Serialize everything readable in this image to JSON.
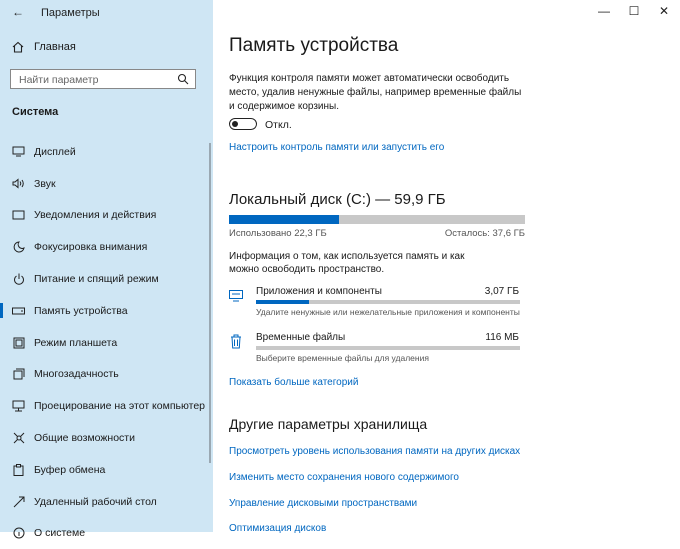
{
  "window": {
    "title": "Параметры",
    "back_icon": "arrow-left-icon",
    "minimize": "—",
    "maximize": "☐",
    "close": "✕"
  },
  "sidebar": {
    "home_label": "Главная",
    "search_placeholder": "Найти параметр",
    "section_title": "Система",
    "items": [
      {
        "label": "Дисплей",
        "icon": "display-icon"
      },
      {
        "label": "Звук",
        "icon": "speaker-icon"
      },
      {
        "label": "Уведомления и действия",
        "icon": "notification-icon"
      },
      {
        "label": "Фокусировка внимания",
        "icon": "moon-icon"
      },
      {
        "label": "Питание и спящий режим",
        "icon": "power-icon"
      },
      {
        "label": "Память устройства",
        "icon": "storage-icon",
        "active": true
      },
      {
        "label": "Режим планшета",
        "icon": "tablet-icon"
      },
      {
        "label": "Многозадачность",
        "icon": "multitask-icon"
      },
      {
        "label": "Проецирование на этот компьютер",
        "icon": "project-icon"
      },
      {
        "label": "Общие возможности",
        "icon": "shared-icon"
      },
      {
        "label": "Буфер обмена",
        "icon": "clipboard-icon"
      },
      {
        "label": "Удаленный рабочий стол",
        "icon": "remote-icon"
      },
      {
        "label": "О системе",
        "icon": "info-icon"
      }
    ]
  },
  "main": {
    "title": "Память устройства",
    "sense_description": "Функция контроля памяти может автоматически освободить место, удалив ненужные файлы, например временные файлы и содержимое корзины.",
    "toggle_state": "Откл.",
    "configure_link": "Настроить контроль памяти или запустить его",
    "disk_title": "Локальный диск (C:) — 59,9 ГБ",
    "disk_used_fraction": 0.373,
    "used_label": "Использовано 22,3 ГБ",
    "free_label": "Осталось: 37,6 ГБ",
    "info_text": "Информация о том, как используется память и как можно освободить пространство.",
    "categories": [
      {
        "name": "Приложения и компоненты",
        "size": "3,07 ГБ",
        "desc": "Удалите ненужные или нежелательные приложения и компоненты",
        "fraction": 0.2
      },
      {
        "name": "Временные файлы",
        "size": "116 МБ",
        "desc": "Выберите временные файлы для удаления",
        "fraction": 0.0
      }
    ],
    "more_link": "Показать больше категорий",
    "other_title": "Другие параметры хранилища",
    "other_links": [
      "Просмотреть уровень использования памяти на других дисках",
      "Изменить место сохранения нового содержимого",
      "Управление дисковыми пространствами",
      "Оптимизация дисков"
    ]
  }
}
